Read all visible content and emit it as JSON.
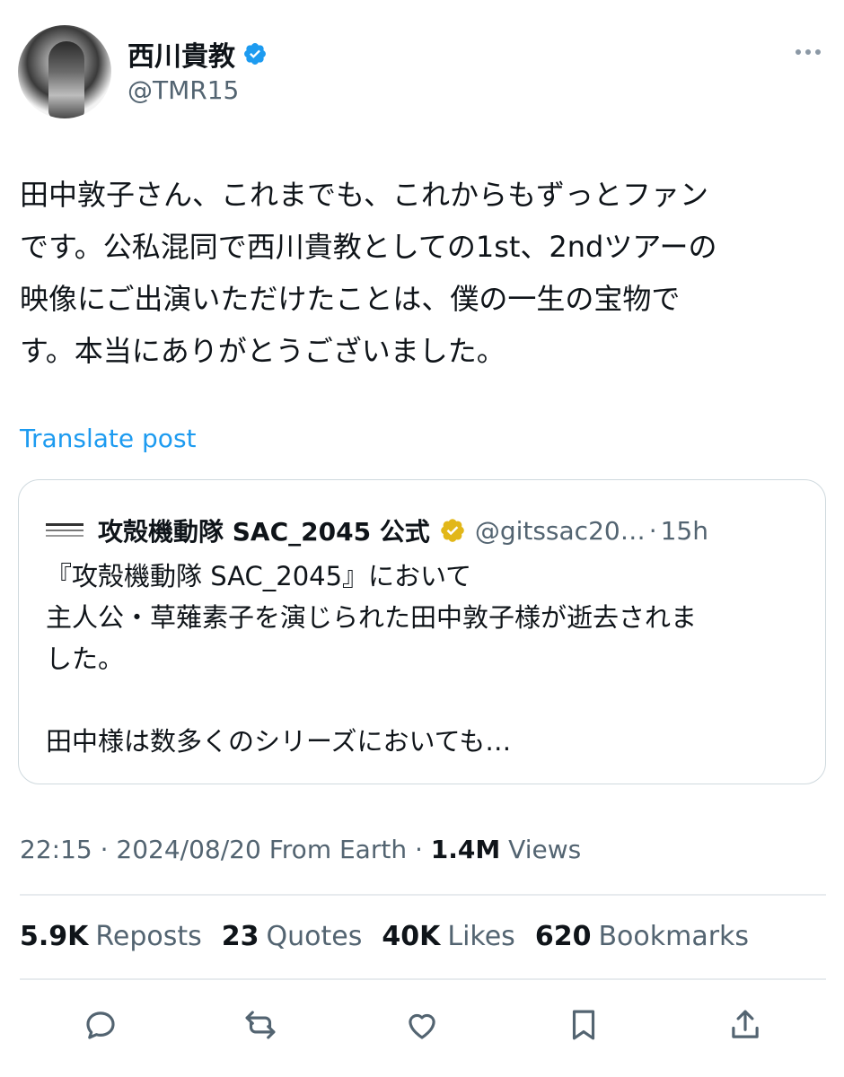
{
  "user": {
    "display_name": "西川貴教",
    "handle": "@TMR15",
    "verified": true
  },
  "tweet": {
    "text": "田中敦子さん、これまでも、これからもずっとファン\nです。公私混同で西川貴教としての1st、2ndツアーの\n映像にご出演いただけたことは、僕の一生の宝物で\nす。本当にありがとうございました。",
    "translate_label": "Translate post"
  },
  "quoted": {
    "name": "攻殻機動隊 SAC_2045 公式",
    "handle": "@gitssac20…",
    "separator": "·",
    "time": "15h",
    "text": "『攻殻機動隊 SAC_2045』において\n主人公・草薙素子を演じられた田中敦子様が逝去されま\nした。\n\n田中様は数多くのシリーズにおいても…"
  },
  "meta": {
    "time": "22:15",
    "date": "2024/08/20",
    "source": "From Earth",
    "views_count": "1.4M",
    "views_label": "Views"
  },
  "stats": [
    {
      "num": "5.9K",
      "label": "Reposts"
    },
    {
      "num": "23",
      "label": "Quotes"
    },
    {
      "num": "40K",
      "label": "Likes"
    },
    {
      "num": "620",
      "label": "Bookmarks"
    }
  ],
  "colors": {
    "link": "#1d9bf0",
    "secondary": "#536471",
    "verified_blue": "#1d9bf0",
    "verified_gold": "#e2b719"
  },
  "icons": [
    "more-icon",
    "verified-badge-icon",
    "gold-verified-badge-icon",
    "reply-icon",
    "repost-icon",
    "like-icon",
    "bookmark-icon",
    "share-icon"
  ]
}
